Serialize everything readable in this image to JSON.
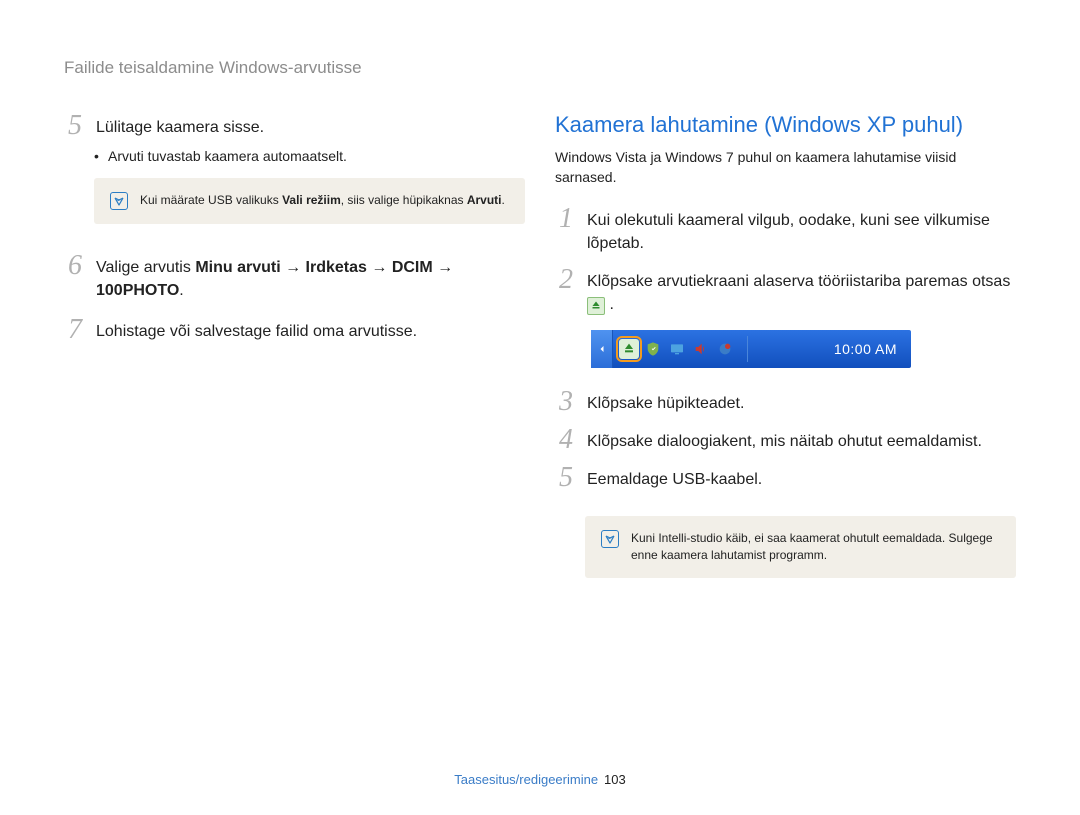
{
  "breadcrumb": "Failide teisaldamine Windows-arvutisse",
  "left": {
    "step5": {
      "num": "5",
      "text": "Lülitage kaamera sisse."
    },
    "step5_sub": "Arvuti tuvastab kaamera automaatselt.",
    "note1_pre": "Kui määrate USB valikuks ",
    "note1_b1": "Vali režiim",
    "note1_mid": ", siis valige hüpikaknas ",
    "note1_b2": "Arvuti",
    "note1_post": ".",
    "step6": {
      "num": "6",
      "pre": "Valige arvutis ",
      "b1": "Minu arvuti",
      "arrow": " → ",
      "b2": "Irdketas",
      "b3": "DCIM",
      "b4": "100PHOTO",
      "post": "."
    },
    "step7": {
      "num": "7",
      "text": "Lohistage või salvestage failid oma arvutisse."
    }
  },
  "right": {
    "title": "Kaamera lahutamine (Windows XP puhul)",
    "intro": "Windows Vista ja Windows 7 puhul on kaamera lahutamise viisid sarnased.",
    "step1": {
      "num": "1",
      "text": "Kui olekutuli kaameral vilgub, oodake, kuni see vilkumise lõpetab."
    },
    "step2": {
      "num": "2",
      "pre": "Klõpsake arvutiekraani alaserva tööriistariba paremas otsas ",
      "post": " ."
    },
    "clock": "10:00 AM",
    "step3": {
      "num": "3",
      "text": "Klõpsake hüpikteadet."
    },
    "step4": {
      "num": "4",
      "text": "Klõpsake dialoogiakent, mis näitab ohutut eemaldamist."
    },
    "step5": {
      "num": "5",
      "text": "Eemaldage USB-kaabel."
    },
    "note2": "Kuni Intelli-studio käib, ei saa kaamerat ohutult eemaldada. Sulgege enne kaamera lahutamist programm."
  },
  "footer": {
    "section": "Taasesitus/redigeerimine",
    "page": "103"
  }
}
